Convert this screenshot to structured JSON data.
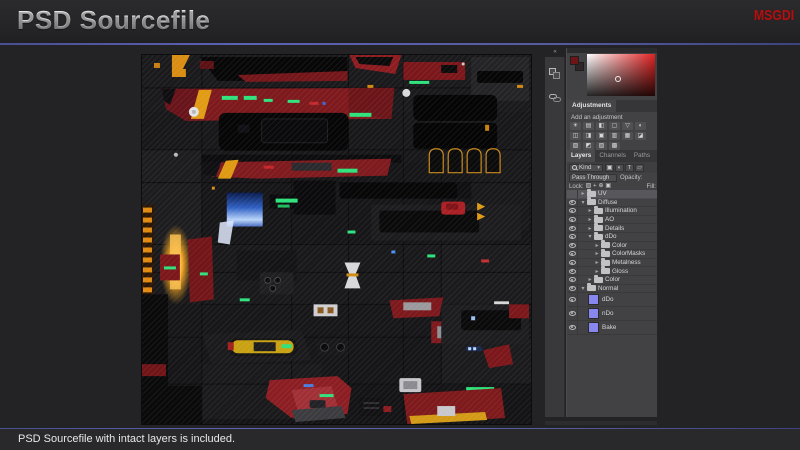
{
  "header": {
    "title": "PSD Sourcefile",
    "logo": "MSGDI"
  },
  "footer": {
    "note": "PSD Sourcefile with intact layers is included."
  },
  "colors": {
    "accent_blue": "#565b9e",
    "logo_red": "#b01212",
    "glow_green": "#2fe27c",
    "panel_bg": "#424244",
    "normal_map_thumb": "#8787ee",
    "picker_hue": "#e02222"
  },
  "photoshop_panel": {
    "adjustments": {
      "tab_label": "Adjustments",
      "hint": "Add an adjustment",
      "icons": [
        {
          "name": "brightness-contrast-icon",
          "glyph": "☀"
        },
        {
          "name": "levels-icon",
          "glyph": "▤"
        },
        {
          "name": "curves-icon",
          "glyph": "◧"
        },
        {
          "name": "exposure-icon",
          "glyph": "▢"
        },
        {
          "name": "vibrance-icon",
          "glyph": "▽"
        },
        {
          "name": "hue-saturation-icon",
          "glyph": "◐"
        },
        {
          "name": "color-balance-icon",
          "glyph": "◫"
        },
        {
          "name": "black-white-icon",
          "glyph": "◨"
        },
        {
          "name": "photo-filter-icon",
          "glyph": "▣"
        },
        {
          "name": "channel-mixer-icon",
          "glyph": "▥"
        },
        {
          "name": "color-lookup-icon",
          "glyph": "▦"
        },
        {
          "name": "invert-icon",
          "glyph": "◪"
        },
        {
          "name": "posterize-icon",
          "glyph": "▧"
        },
        {
          "name": "threshold-icon",
          "glyph": "◩"
        },
        {
          "name": "gradient-map-icon",
          "glyph": "▨"
        },
        {
          "name": "selective-color-icon",
          "glyph": "▩"
        }
      ]
    },
    "panel_tabs": [
      {
        "label": "Layers",
        "active": true
      },
      {
        "label": "Channels",
        "active": false
      },
      {
        "label": "Paths",
        "active": false
      }
    ],
    "filter_row": {
      "kind_label": "Kind",
      "type_icons": [
        {
          "name": "pixel-layer-filter-icon",
          "glyph": "▣"
        },
        {
          "name": "adjustment-layer-filter-icon",
          "glyph": "◐"
        },
        {
          "name": "type-layer-filter-icon",
          "glyph": "T"
        },
        {
          "name": "shape-layer-filter-icon",
          "glyph": "▱"
        }
      ]
    },
    "blend_row": {
      "blend_mode": "Pass Through",
      "opacity_label": "Opacity:"
    },
    "lock_row": {
      "lock_label": "Lock:",
      "fill_label": "Fill:",
      "icons": [
        {
          "name": "lock-transparency-icon",
          "glyph": "▨"
        },
        {
          "name": "lock-paint-icon",
          "glyph": "+"
        },
        {
          "name": "lock-position-icon",
          "glyph": "⊕"
        },
        {
          "name": "lock-all-icon",
          "glyph": "▣"
        }
      ]
    },
    "layers": [
      {
        "name": "UV",
        "kind": "group",
        "indent": 0,
        "expanded": false,
        "visible": false,
        "selected": true
      },
      {
        "name": "Diffuse",
        "kind": "group",
        "indent": 0,
        "expanded": true,
        "visible": true,
        "selected": false
      },
      {
        "name": "Illumination",
        "kind": "group",
        "indent": 1,
        "expanded": false,
        "visible": true,
        "selected": false
      },
      {
        "name": "AO",
        "kind": "group",
        "indent": 1,
        "expanded": false,
        "visible": true,
        "selected": false
      },
      {
        "name": "Details",
        "kind": "group",
        "indent": 1,
        "expanded": false,
        "visible": true,
        "selected": false
      },
      {
        "name": "dDo",
        "kind": "group",
        "indent": 1,
        "expanded": true,
        "visible": true,
        "selected": false
      },
      {
        "name": "Color",
        "kind": "group",
        "indent": 2,
        "expanded": false,
        "visible": true,
        "selected": false
      },
      {
        "name": "ColorMasks",
        "kind": "group",
        "indent": 2,
        "expanded": false,
        "visible": true,
        "selected": false
      },
      {
        "name": "Metalness",
        "kind": "group",
        "indent": 2,
        "expanded": false,
        "visible": true,
        "selected": false
      },
      {
        "name": "Gloss",
        "kind": "group",
        "indent": 2,
        "expanded": false,
        "visible": true,
        "selected": false
      },
      {
        "name": "Color",
        "kind": "group",
        "indent": 1,
        "expanded": false,
        "visible": true,
        "selected": false
      },
      {
        "name": "Normal",
        "kind": "group",
        "indent": 0,
        "expanded": true,
        "visible": true,
        "selected": false
      },
      {
        "name": "dDo",
        "kind": "pixel",
        "indent": 1,
        "visible": true,
        "selected": false
      },
      {
        "name": "nDo",
        "kind": "pixel",
        "indent": 1,
        "visible": true,
        "selected": false
      },
      {
        "name": "Bake",
        "kind": "pixel",
        "indent": 1,
        "visible": true,
        "selected": false
      }
    ]
  }
}
